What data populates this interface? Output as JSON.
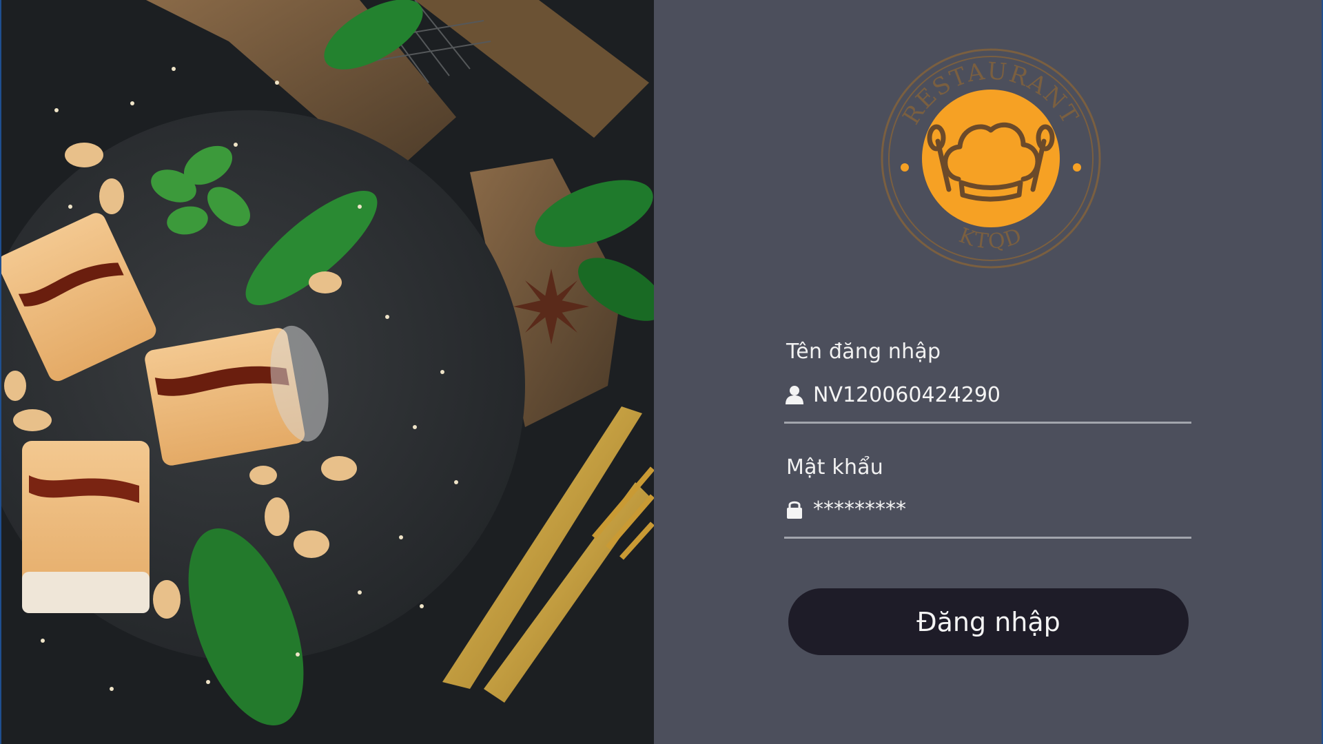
{
  "hero": {
    "image": "dessert-on-slate-board"
  },
  "logo": {
    "top_text": "RESTAURANT",
    "bottom_text": "KTQD",
    "icon": "chef-hat-icon",
    "ring_color": "#7a5f40",
    "disc_color": "#f6a124"
  },
  "form": {
    "username": {
      "label": "Tên đăng nhập",
      "value": "NV120060424290",
      "icon": "user-icon"
    },
    "password": {
      "label": "Mật khẩu",
      "value": "*********",
      "icon": "lock-icon"
    },
    "submit_label": "Đăng nhập"
  },
  "colors": {
    "panel_bg": "#4c4f5c",
    "button_bg": "#1e1c28",
    "text": "#f1f1f1",
    "underline": "#a2a5ad",
    "accent": "#f6a124"
  }
}
